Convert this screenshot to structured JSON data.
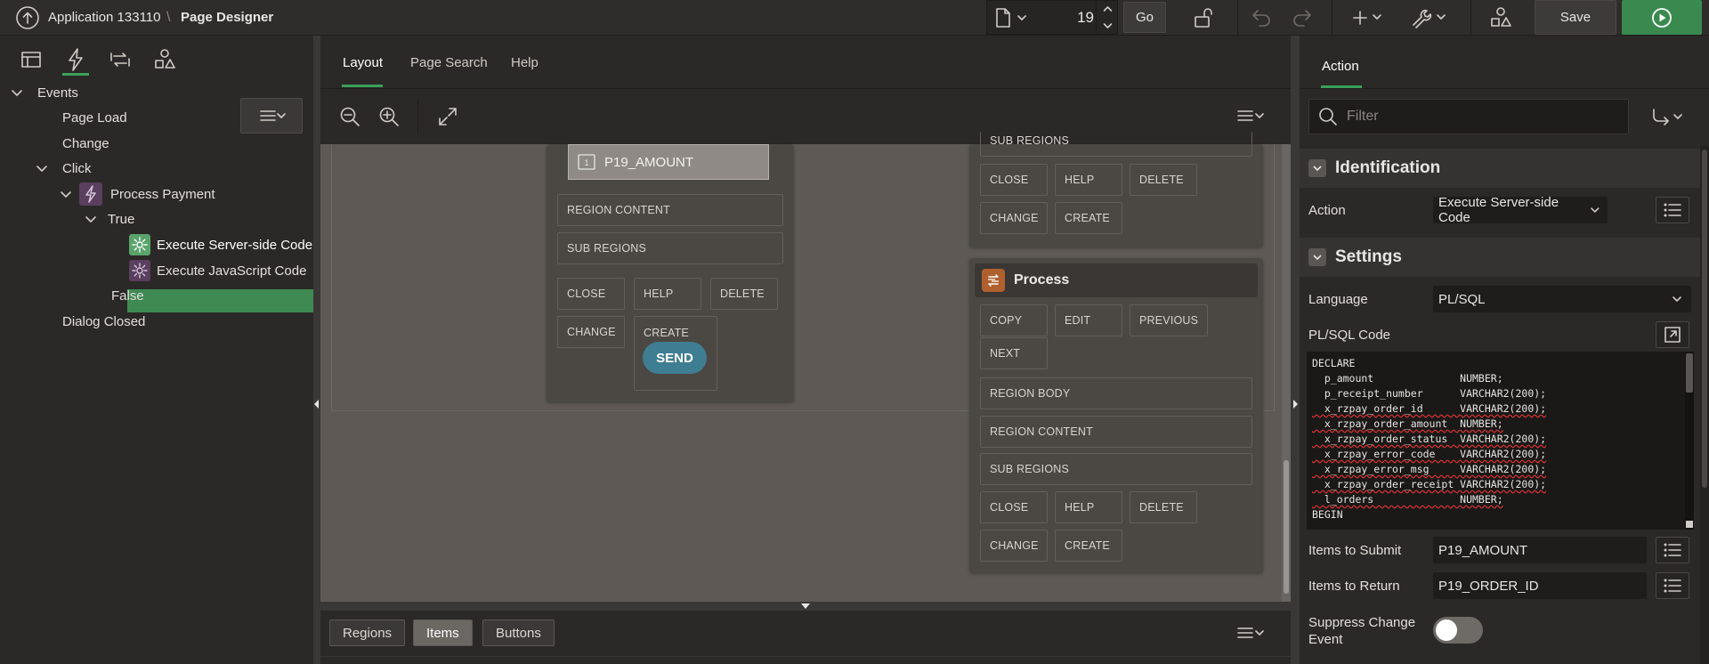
{
  "header": {
    "app_name": "Application 133110",
    "separator": "\\",
    "page_name": "Page Designer",
    "page_number": "19",
    "go_label": "Go",
    "save_label": "Save"
  },
  "left": {
    "tree": [
      {
        "label": "Events"
      },
      {
        "label": "Page Load"
      },
      {
        "label": "Change"
      },
      {
        "label": "Click"
      },
      {
        "label": "Process Payment"
      },
      {
        "label": "True"
      },
      {
        "label": "Execute Server-side Code"
      },
      {
        "label": "Execute JavaScript Code"
      },
      {
        "label": "False"
      },
      {
        "label": "Dialog Closed"
      }
    ]
  },
  "center": {
    "tabs": [
      "Layout",
      "Page Search",
      "Help"
    ],
    "left_region": {
      "item": "P19_AMOUNT",
      "region_content": "REGION CONTENT",
      "sub_regions": "SUB REGIONS",
      "buttons": [
        "CLOSE",
        "HELP",
        "DELETE",
        "CHANGE",
        "CREATE"
      ],
      "send": "SEND"
    },
    "right_top": {
      "sub_regions": "SUB REGIONS",
      "buttons": [
        "CLOSE",
        "HELP",
        "DELETE",
        "CHANGE",
        "CREATE"
      ]
    },
    "process_region": {
      "title": "Process",
      "buttons1": [
        "COPY",
        "EDIT",
        "PREVIOUS",
        "NEXT"
      ],
      "region_body": "REGION BODY",
      "region_content": "REGION CONTENT",
      "sub_regions": "SUB REGIONS",
      "buttons2": [
        "CLOSE",
        "HELP",
        "DELETE",
        "CHANGE",
        "CREATE"
      ]
    },
    "bottom_tabs": [
      "Regions",
      "Items",
      "Buttons"
    ]
  },
  "right": {
    "tab": "Action",
    "filter_placeholder": "Filter",
    "identification": {
      "title": "Identification",
      "action_label": "Action",
      "action_value": "Execute Server-side Code"
    },
    "settings": {
      "title": "Settings",
      "language_label": "Language",
      "language_value": "PL/SQL",
      "code_label": "PL/SQL Code",
      "code_lines": [
        "DECLARE",
        "  p_amount              NUMBER;",
        "  p_receipt_number      VARCHAR2(200);",
        "  x_rzpay_order_id      VARCHAR2(200);",
        "  x_rzpay_order_amount  NUMBER;",
        "  x_rzpay_order_status  VARCHAR2(200);",
        "  x_rzpay_error_code    VARCHAR2(200);",
        "  x_rzpay_error_msg     VARCHAR2(200);",
        "  x_rzpay_order_receipt VARCHAR2(200);",
        "  l_orders              NUMBER;",
        "BEGIN"
      ],
      "items_submit_label": "Items to Submit",
      "items_submit_value": "P19_AMOUNT",
      "items_return_label": "Items to Return",
      "items_return_value": "P19_ORDER_ID",
      "suppress_label_1": "Suppress Change",
      "suppress_label_2": "Event"
    }
  }
}
